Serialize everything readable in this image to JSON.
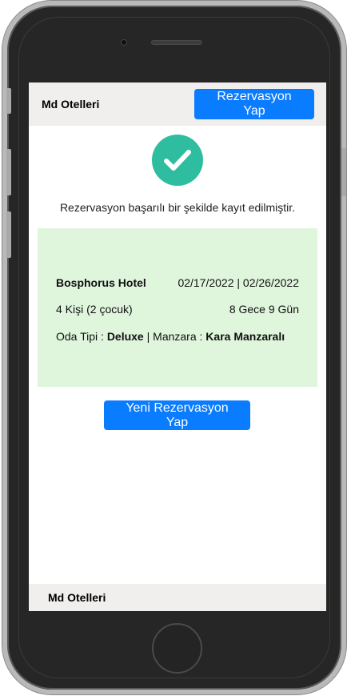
{
  "navbar": {
    "brand": "Md Otelleri",
    "reserve_button": "Rezervasyon Yap"
  },
  "success": {
    "icon": "check-circle-icon",
    "message": "Rezervasyon başarılı bir şekilde kayıt edilmiştir."
  },
  "reservation": {
    "hotel": "Bosphorus Hotel",
    "dates": "02/17/2022 | 02/26/2022",
    "guests": "4 Kişi (2 çocuk)",
    "duration": "8 Gece 9 Gün",
    "room_type_label": "Oda Tipi : ",
    "room_type": "Deluxe",
    "separator": " | ",
    "view_label": "Manzara : ",
    "view": "Kara Manzaralı"
  },
  "actions": {
    "new_reservation_button": "Yeni Rezervasyon Yap"
  },
  "footer": {
    "brand": "Md Otelleri"
  },
  "colors": {
    "primary": "#0a7cff",
    "success": "#2ebd9f",
    "card_bg": "#dff5dc",
    "bar_bg": "#f1efee"
  }
}
